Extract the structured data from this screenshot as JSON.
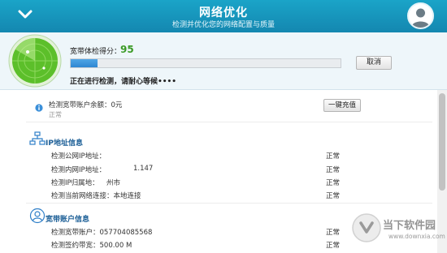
{
  "titlebar": {
    "title": "网络优化",
    "subtitle": "检测并优化您的网络配置与质量"
  },
  "header": {
    "score_label": "宽带体检得分：",
    "score_value": "95",
    "progress": 0.1,
    "cancel_label": "取消",
    "status_text": "正在进行检测，请耐心等候••••"
  },
  "account_balance": {
    "label": "检测宽带账户余额：0元",
    "status": "正常",
    "recharge_label": "一键充值"
  },
  "ip_section": {
    "title": "IP地址信息",
    "rows": [
      {
        "label": "检测公网IP地址：",
        "status": "正常"
      },
      {
        "label": "检测内网IP地址：",
        "value": "1.147",
        "status": "正常"
      },
      {
        "label": "检测IP归属地：",
        "value": "州市",
        "status": "正常"
      },
      {
        "label": "检测当前网络连接：本地连接",
        "status": "正常"
      }
    ]
  },
  "account_section": {
    "title": "宽带账户信息",
    "rows": [
      {
        "label": "检测宽带账户：057704085568",
        "status": "正常"
      },
      {
        "label": "检测签约带宽：500.00 M",
        "status": "正常"
      }
    ]
  },
  "watermark": {
    "main": "当下软件园",
    "url": "www.downxia.com"
  },
  "colors": {
    "titlebar": "#1797bf",
    "accent_green": "#3a9a25",
    "progress_blue": "#2e86d2",
    "section_blue": "#1b5e96"
  }
}
